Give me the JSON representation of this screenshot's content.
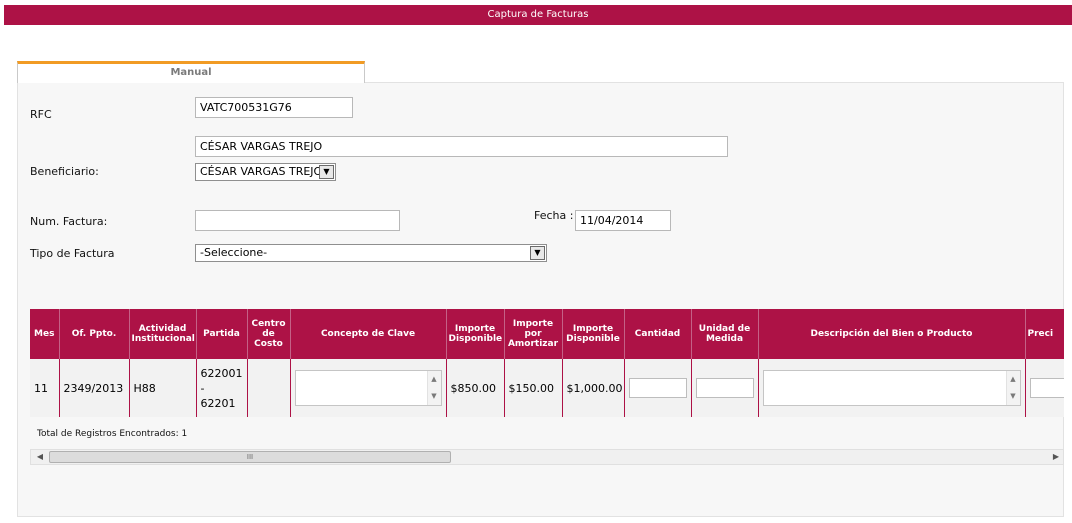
{
  "title": "Captura de Facturas",
  "tabs": [
    {
      "label": "Manual"
    }
  ],
  "form": {
    "rfc_label": "RFC",
    "rfc_value": "VATC700531G76",
    "beneficiario_name": "CÉSAR VARGAS TREJO",
    "beneficiario_label": "Beneficiario:",
    "beneficiario_select": "CÉSAR VARGAS TREJO",
    "num_factura_label": "Num. Factura:",
    "num_factura_value": "",
    "fecha_label": "Fecha :",
    "fecha_value": "11/04/2014",
    "tipo_factura_label": "Tipo de Factura",
    "tipo_factura_value": "-Seleccione-"
  },
  "grid": {
    "headers": [
      "Mes",
      "Of. Ppto.",
      "Actividad Institucional",
      "Partida",
      "Centro de Costo",
      "Concepto de Clave",
      "Importe Disponible",
      "Importe por Amortizar",
      "Importe Disponible",
      "Cantidad",
      "Unidad de Medida",
      "Descripción del Bien o Producto",
      "Preci"
    ],
    "rows": [
      {
        "mes": "11",
        "of_ppto": "2349/2013",
        "actividad": "H88",
        "partida": "622001\n-\n62201",
        "centro": "",
        "importe_disponible": "$850.00",
        "importe_amortizar": "$150.00",
        "importe_disponible2": "$1,000.00"
      }
    ],
    "total_text": "Total de Registros Encontrados: 1"
  },
  "icons": {
    "dropdown": "▼",
    "scroll_up": "▲",
    "scroll_down": "▼",
    "scroll_left": "◀",
    "scroll_right": "▶",
    "thumb_grip": "III"
  },
  "colors": {
    "accent": "#ad1246",
    "tab_active": "#f19b24"
  }
}
